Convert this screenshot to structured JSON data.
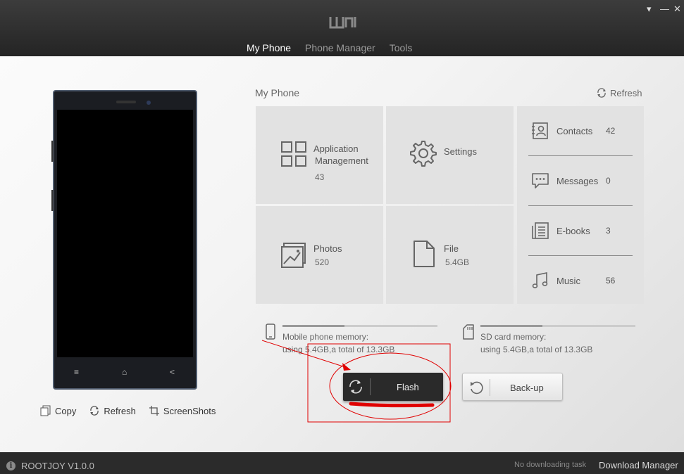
{
  "app": {
    "logo": "UMI",
    "window_controls": {
      "menu": "▾",
      "minimize": "—",
      "close": "✕"
    }
  },
  "tabs": [
    {
      "label": "My Phone",
      "active": true
    },
    {
      "label": "Phone Manager",
      "active": false
    },
    {
      "label": "Tools",
      "active": false
    }
  ],
  "phone_actions": {
    "copy": "Copy",
    "refresh": "Refresh",
    "screenshots": "ScreenShots"
  },
  "panel": {
    "title": "My Phone",
    "refresh": "Refresh"
  },
  "tiles": {
    "apps": {
      "label_line1": "Application",
      "label_line2": "Management",
      "count": "43",
      "icon": "grid-icon"
    },
    "settings": {
      "label": "Settings",
      "icon": "gear-icon"
    },
    "photos": {
      "label": "Photos",
      "count": "520",
      "icon": "photo-icon"
    },
    "file": {
      "label": "File",
      "count": "5.4GB",
      "icon": "file-icon"
    }
  },
  "media_list": [
    {
      "label": "Contacts",
      "count": "42",
      "icon": "contacts-icon"
    },
    {
      "label": "Messages",
      "count": "0",
      "icon": "messages-icon"
    },
    {
      "label": "E-books",
      "count": "3",
      "icon": "ebooks-icon"
    },
    {
      "label": "Music",
      "count": "56",
      "icon": "music-icon"
    }
  ],
  "memory": {
    "phone": {
      "title": "Mobile phone memory:",
      "usage": "using 5.4GB,a total of 13.3GB",
      "used_fraction": 0.4
    },
    "sd": {
      "title": "SD card memory:",
      "usage": "using 5.4GB,a total of 13.3GB",
      "used_fraction": 0.4
    }
  },
  "buttons": {
    "flash": "Flash",
    "backup": "Back-up"
  },
  "footer": {
    "version": "ROOTJOY V1.0.0",
    "download_status": "No downloading task",
    "download_manager": "Download Manager"
  },
  "colors": {
    "header_bg": "#2e2e2e",
    "tile_bg": "#e2e2e2",
    "annotation_red": "#e00000",
    "tab_active": "#ffffff",
    "tab_inactive": "#9a9a9a"
  }
}
